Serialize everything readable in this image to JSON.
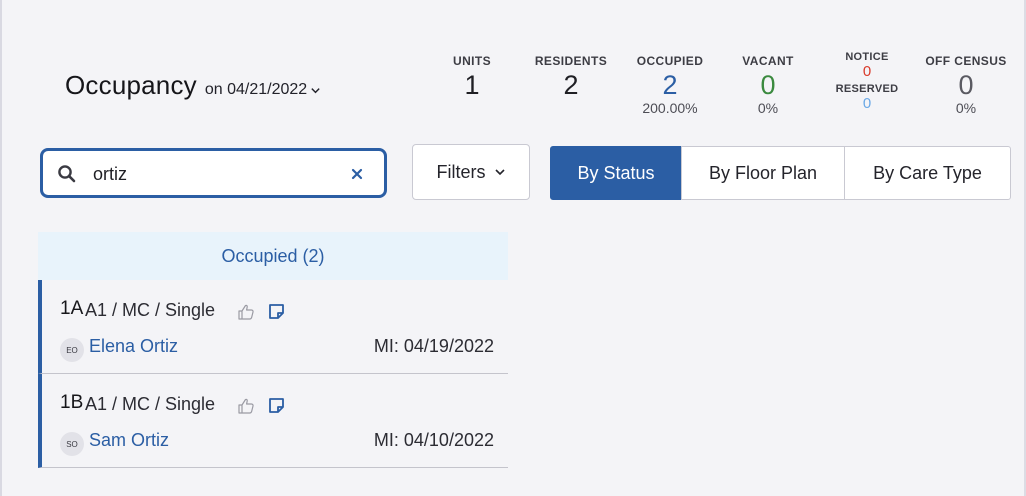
{
  "header": {
    "title": "Occupancy",
    "date_label": "on 04/21/2022"
  },
  "stats": {
    "units": {
      "label": "UNITS",
      "value": "1"
    },
    "residents": {
      "label": "RESIDENTS",
      "value": "2"
    },
    "occupied": {
      "label": "OCCUPIED",
      "value": "2",
      "pct": "200.00%"
    },
    "vacant": {
      "label": "VACANT",
      "value": "0",
      "pct": "0%"
    },
    "notice": {
      "label": "NOTICE",
      "value": "0"
    },
    "reserved": {
      "label": "RESERVED",
      "value": "0"
    },
    "off_census": {
      "label": "OFF CENSUS",
      "value": "0",
      "pct": "0%"
    }
  },
  "colors": {
    "accent": "#2b5ea4",
    "occupied": "#2b5ea4",
    "vacant": "#3b8a3f",
    "notice": "#d93a2b",
    "reserved": "#6aa8e6",
    "off_census": "#5a5a62"
  },
  "search": {
    "value": "ortiz",
    "icon": "search-icon",
    "clear_icon": "close-icon"
  },
  "filters": {
    "label": "Filters"
  },
  "view_tabs": [
    {
      "label": "By Status",
      "active": true
    },
    {
      "label": "By Floor Plan",
      "active": false
    },
    {
      "label": "By Care Type",
      "active": false
    }
  ],
  "groups": [
    {
      "title": "Occupied (2)",
      "rows": [
        {
          "unit": "1A",
          "meta": "A1 / MC / Single",
          "initials": "EO",
          "name": "Elena Ortiz",
          "move_in": "MI: 04/19/2022"
        },
        {
          "unit": "1B",
          "meta": "A1 / MC / Single",
          "initials": "SO",
          "name": "Sam Ortiz",
          "move_in": "MI: 04/10/2022"
        }
      ]
    }
  ]
}
